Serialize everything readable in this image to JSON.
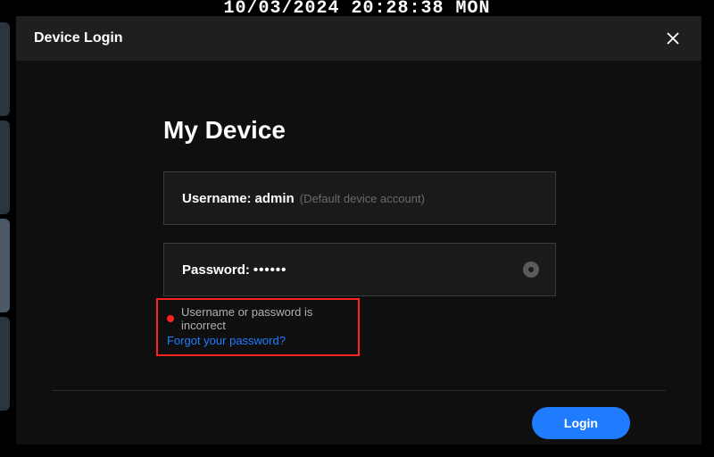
{
  "overlay": {
    "timestamp": "10/03/2024 20:28:38 MON"
  },
  "modal": {
    "title": "Device Login",
    "device_name": "My Device",
    "username": {
      "label": "Username:",
      "value": "admin",
      "hint": "(Default device account)"
    },
    "password": {
      "label": "Password:",
      "masked": "••••••"
    },
    "error": {
      "message": "Username or password is incorrect",
      "forgot_link": "Forgot your password?"
    },
    "login_button": "Login"
  }
}
